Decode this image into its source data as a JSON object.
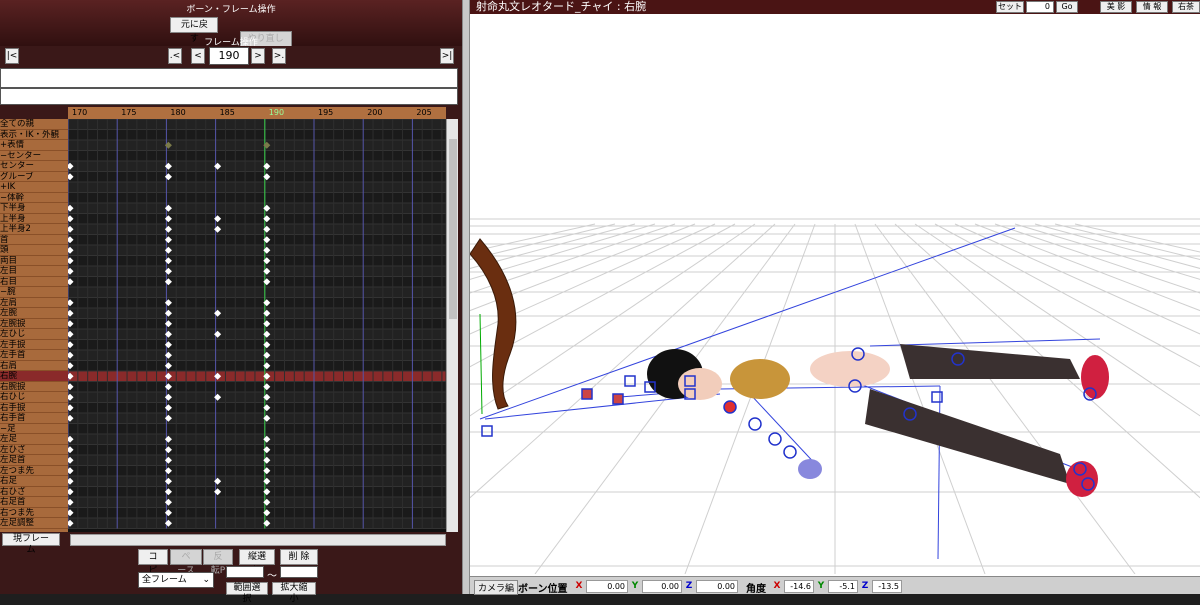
{
  "panel": {
    "title": "ボーン・フレーム操作",
    "undo_label": "元に戻す",
    "redo_label": "やり直し",
    "frame_label": "フレーム操作",
    "current_frame": "190",
    "nav_first": "|<",
    "nav_prev_key": ".<",
    "nav_prev": "<",
    "nav_next": ">",
    "nav_next_key": ">.",
    "nav_last": ">|"
  },
  "timeline": {
    "ruler": [
      "170",
      "175",
      "180",
      "185",
      "190",
      "195",
      "200",
      "205"
    ],
    "tracks": [
      "全ての親",
      "表示・IK・外観",
      "+表情",
      "−センター",
      "センター",
      "グルーブ",
      "+IK",
      "−体幹",
      "下半身",
      "上半身",
      "上半身2",
      "首",
      "頭",
      "両目",
      "左目",
      "右目",
      "−腕",
      "左肩",
      "左腕",
      "左腕捩",
      "左ひじ",
      "左手捩",
      "左手首",
      "右肩",
      "右腕",
      "右腕捩",
      "右ひじ",
      "右手捩",
      "右手首",
      "−足",
      "左足",
      "左ひざ",
      "左足首",
      "左つま先",
      "右足",
      "右ひざ",
      "右足首",
      "右つま先",
      "左足調整"
    ]
  },
  "bottom": {
    "current_frame_button": "現フレーム",
    "copy": "コピー",
    "paste": "ペースト",
    "reverse_paste": "反転P",
    "vertical_select": "縦選択",
    "delete": "削 除",
    "range_select": "範囲選択",
    "scale": "拡大縮小",
    "range_dropdown": "全フレーム",
    "range_tilde": "〜"
  },
  "viewer": {
    "title": "射命丸文レオタード_チャイ : 右腕",
    "set_label": "セット",
    "set_value": "0",
    "go_label": "Go",
    "shadow_label": "美 影",
    "info_label": "情 報",
    "right_label": "右茶"
  },
  "status": {
    "camera_tab": "カメラ編",
    "bone_pos_label": "ボーン位置",
    "pos_x": "0.00",
    "pos_y": "0.00",
    "pos_z": "0.00",
    "angle_label": "角度",
    "ang_x": "-14.6",
    "ang_y": "-5.1",
    "ang_z": "-13.5",
    "x": "X",
    "y": "Y",
    "z": "Z"
  },
  "colors": {
    "panel_bg": "#3a1818",
    "track_bg": "#a86a3c",
    "keyframe": "#ffffff",
    "selected_row": "#8a2a2a",
    "grid_floor": "#c8c8c8",
    "bone_blue": "#3333cc"
  }
}
